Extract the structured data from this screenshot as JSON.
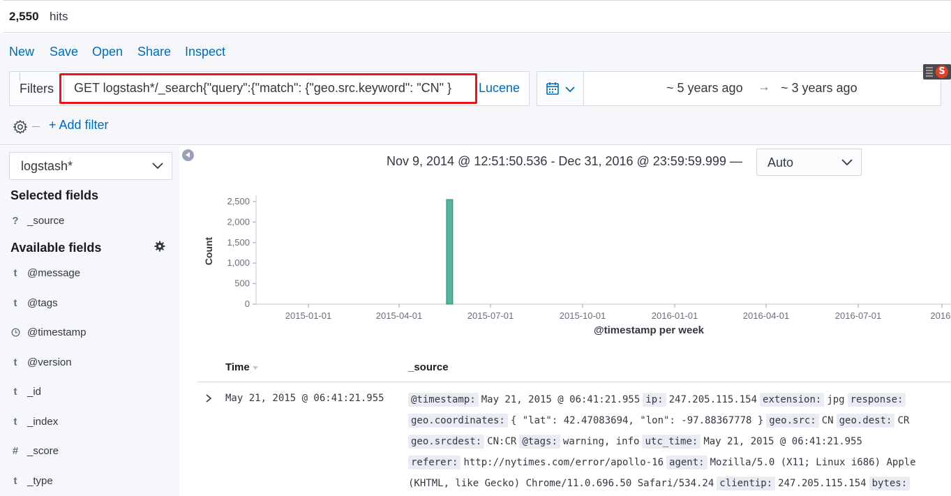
{
  "hits": {
    "count": "2,550",
    "label": "hits"
  },
  "menu": {
    "new": "New",
    "save": "Save",
    "open": "Open",
    "share": "Share",
    "inspect": "Inspect"
  },
  "query": {
    "filters_label": "Filters",
    "text": "GET logstash*/_search{\"query\":{\"match\": {\"geo.src.keyword\": \"CN\" }",
    "language": "Lucene",
    "highlight_color": "#e7151b"
  },
  "date": {
    "start": "~ 5 years ago",
    "arrow": "→",
    "end": "~ 3 years ago",
    "icon": "calendar-icon"
  },
  "filters": {
    "add_filter": "+ Add filter"
  },
  "sidebar": {
    "index_pattern": "logstash*",
    "selected_title": "Selected fields",
    "selected_fields": [
      {
        "type": "?",
        "name": "_source"
      }
    ],
    "available_title": "Available fields",
    "available_fields": [
      {
        "type": "t",
        "name": "@message"
      },
      {
        "type": "t",
        "name": "@tags"
      },
      {
        "type": "clock",
        "name": "@timestamp"
      },
      {
        "type": "t",
        "name": "@version"
      },
      {
        "type": "t",
        "name": "_id"
      },
      {
        "type": "t",
        "name": "_index"
      },
      {
        "type": "#",
        "name": "_score"
      },
      {
        "type": "t",
        "name": "_type"
      }
    ]
  },
  "histogram": {
    "range_text": "Nov 9, 2014 @ 12:51:50.536 - Dec 31, 2016 @ 23:59:59.999 —",
    "interval": "Auto"
  },
  "chart_data": {
    "type": "bar",
    "xlabel": "@timestamp per week",
    "ylabel": "Count",
    "x_ticks": [
      "2015-01-01",
      "2015-04-01",
      "2015-07-01",
      "2015-10-01",
      "2016-01-01",
      "2016-04-01",
      "2016-07-01",
      "2016-"
    ],
    "y_ticks": [
      "0",
      "500",
      "1,000",
      "1,500",
      "2,000",
      "2,500"
    ],
    "ylim": [
      0,
      2550
    ],
    "series": [
      {
        "bars": [
          {
            "week_of": "2015-05-18",
            "value": 2550
          }
        ]
      }
    ],
    "bar_color": "#54b399"
  },
  "table": {
    "headers": {
      "time": "Time",
      "source": "_source"
    },
    "rows": [
      {
        "time": "May 21, 2015 @ 06:41:21.955",
        "source_lines": [
          [
            [
              "@timestamp:",
              "May 21, 2015 @ 06:41:21.955"
            ],
            [
              "ip:",
              "247.205.115.154"
            ],
            [
              "extension:",
              "jpg"
            ],
            [
              "response:",
              ""
            ]
          ],
          [
            [
              "geo.coordinates:",
              "{ \"lat\": 42.47083694, \"lon\": -97.88367778 }"
            ],
            [
              "geo.src:",
              "CN"
            ],
            [
              "geo.dest:",
              "CR"
            ]
          ],
          [
            [
              "geo.srcdest:",
              "CN:CR"
            ],
            [
              "@tags:",
              "warning, info"
            ],
            [
              "utc_time:",
              "May 21, 2015 @ 06:41:21.955"
            ]
          ],
          [
            [
              "referer:",
              "http://nytimes.com/error/apollo-16"
            ],
            [
              "agent:",
              "Mozilla/5.0 (X11; Linux i686) Apple"
            ]
          ],
          [
            [
              "",
              "(KHTML, like Gecko) Chrome/11.0.696.50 Safari/534.24"
            ],
            [
              "clientip:",
              "247.205.115.154"
            ],
            [
              "bytes:",
              ""
            ]
          ]
        ]
      }
    ]
  }
}
